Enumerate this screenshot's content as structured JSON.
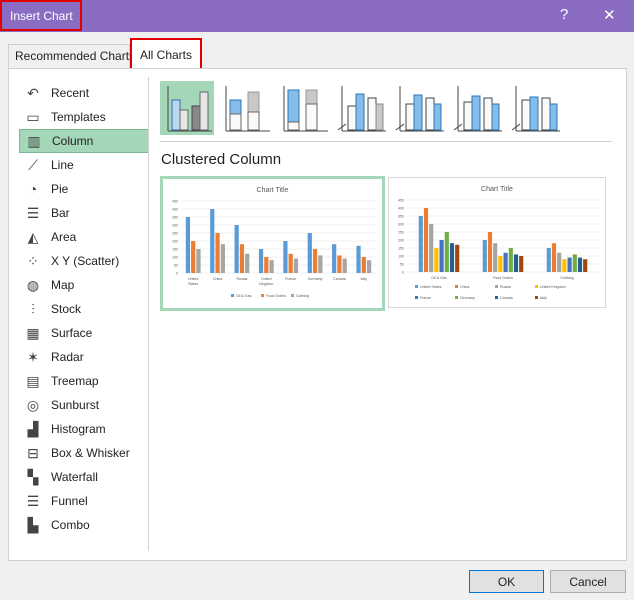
{
  "window": {
    "title": "Insert Chart",
    "help_label": "?",
    "close_label": "✕",
    "accent": "#8a6cc2"
  },
  "tabs": [
    {
      "label": "Recommended Charts"
    },
    {
      "label": "All Charts",
      "selected": true
    }
  ],
  "sidebar": {
    "items": [
      {
        "label": "Recent",
        "icon": "undo-icon"
      },
      {
        "label": "Templates",
        "icon": "folder-icon"
      },
      {
        "label": "Column",
        "icon": "column-chart-icon",
        "selected": true
      },
      {
        "label": "Line",
        "icon": "line-chart-icon"
      },
      {
        "label": "Pie",
        "icon": "pie-chart-icon"
      },
      {
        "label": "Bar",
        "icon": "bar-chart-icon"
      },
      {
        "label": "Area",
        "icon": "area-chart-icon"
      },
      {
        "label": "X Y (Scatter)",
        "icon": "scatter-chart-icon"
      },
      {
        "label": "Map",
        "icon": "globe-icon"
      },
      {
        "label": "Stock",
        "icon": "stock-chart-icon"
      },
      {
        "label": "Surface",
        "icon": "surface-chart-icon"
      },
      {
        "label": "Radar",
        "icon": "radar-chart-icon"
      },
      {
        "label": "Treemap",
        "icon": "treemap-icon"
      },
      {
        "label": "Sunburst",
        "icon": "sunburst-icon"
      },
      {
        "label": "Histogram",
        "icon": "histogram-icon"
      },
      {
        "label": "Box & Whisker",
        "icon": "box-whisker-icon"
      },
      {
        "label": "Waterfall",
        "icon": "waterfall-icon"
      },
      {
        "label": "Funnel",
        "icon": "funnel-icon"
      },
      {
        "label": "Combo",
        "icon": "combo-chart-icon"
      }
    ]
  },
  "subtypes": [
    "clustered-column",
    "stacked-column",
    "100-stacked-column",
    "3d-clustered-column",
    "3d-stacked-column",
    "3d-100-stacked-column",
    "3d-column"
  ],
  "main": {
    "subtype_title": "Clustered Column"
  },
  "chart_data": [
    {
      "type": "bar",
      "title": "Chart Title",
      "categories": [
        "United States",
        "China",
        "Russia",
        "United Kingdom",
        "France",
        "Germany",
        "Canada",
        "Italy"
      ],
      "series": [
        {
          "name": "Oil & Gas",
          "values": [
            350,
            400,
            300,
            150,
            200,
            250,
            180,
            170
          ]
        },
        {
          "name": "Food Grains",
          "values": [
            200,
            250,
            180,
            100,
            120,
            150,
            110,
            100
          ]
        },
        {
          "name": "Clothing",
          "values": [
            150,
            180,
            120,
            80,
            90,
            110,
            90,
            80
          ]
        }
      ],
      "ylim": [
        0,
        450
      ],
      "yticks": [
        0,
        50,
        100,
        150,
        200,
        250,
        300,
        350,
        400,
        450
      ],
      "grid": true,
      "legend": "bottom",
      "colors": [
        "#5b9bd5",
        "#ed7d31",
        "#a5a5a5"
      ]
    },
    {
      "type": "bar",
      "title": "Chart Title",
      "categories": [
        "Oil & Gas",
        "Food Grains",
        "Clothing"
      ],
      "series": [
        {
          "name": "United States",
          "values": [
            350,
            200,
            150
          ]
        },
        {
          "name": "China",
          "values": [
            400,
            250,
            180
          ]
        },
        {
          "name": "Russia",
          "values": [
            300,
            180,
            120
          ]
        },
        {
          "name": "United Kingdom",
          "values": [
            150,
            100,
            80
          ]
        },
        {
          "name": "France",
          "values": [
            200,
            120,
            90
          ]
        },
        {
          "name": "Germany",
          "values": [
            250,
            150,
            110
          ]
        },
        {
          "name": "Canada",
          "values": [
            180,
            110,
            90
          ]
        },
        {
          "name": "Italy",
          "values": [
            170,
            100,
            80
          ]
        }
      ],
      "ylim": [
        0,
        450
      ],
      "yticks": [
        0,
        50,
        100,
        150,
        200,
        250,
        300,
        350,
        400,
        450
      ],
      "grid": true,
      "legend": "bottom",
      "colors": [
        "#5b9bd5",
        "#ed7d31",
        "#a5a5a5",
        "#ffc000",
        "#4472c4",
        "#70ad47",
        "#255e91",
        "#9e480e"
      ]
    }
  ],
  "buttons": {
    "ok": "OK",
    "cancel": "Cancel"
  }
}
